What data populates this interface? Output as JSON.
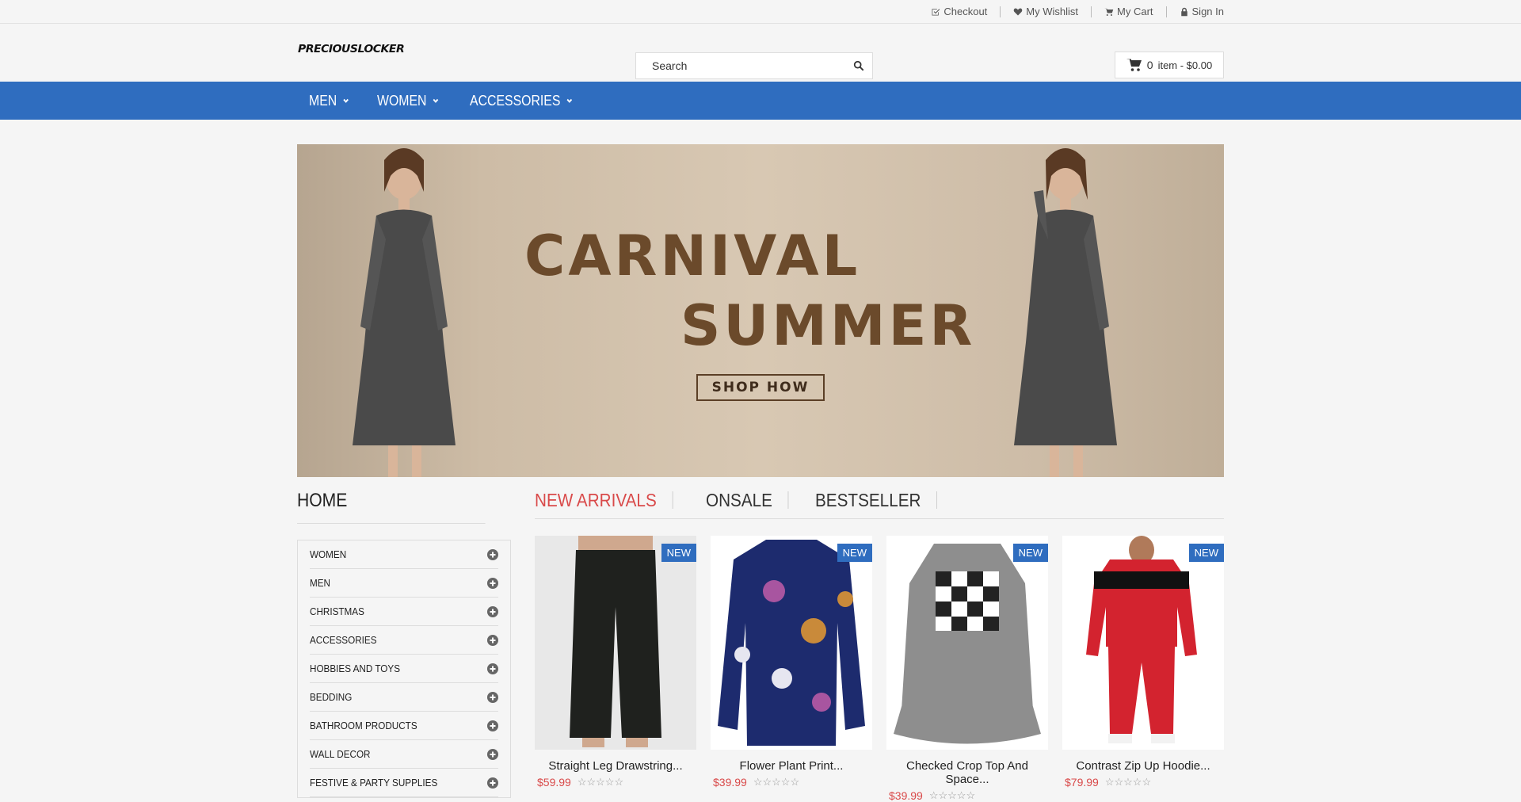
{
  "toplinks": [
    {
      "label": "Checkout",
      "icon": "checkout-icon"
    },
    {
      "label": "My Wishlist",
      "icon": "heart-icon"
    },
    {
      "label": "My Cart",
      "icon": "cart-icon"
    },
    {
      "label": "Sign In",
      "icon": "lock-icon"
    }
  ],
  "header": {
    "logo": "PRECIOUSLOCKER",
    "search_placeholder": "Search",
    "cart_count": "0",
    "cart_summary": "item - $0.00"
  },
  "nav": [
    {
      "label": "MEN"
    },
    {
      "label": "WOMEN"
    },
    {
      "label": "ACCESSORIES"
    }
  ],
  "banner": {
    "line1": "CARNIVAL",
    "line2": "SUMMER",
    "button": "SHOP HOW"
  },
  "sidebar": {
    "title": "HOME",
    "categories": [
      "WOMEN",
      "MEN",
      "CHRISTMAS",
      "ACCESSORIES",
      "HOBBIES AND TOYS",
      "BEDDING",
      "BATHROOM PRODUCTS",
      "WALL DECOR",
      "FESTIVE & PARTY SUPPLIES"
    ]
  },
  "tabs": [
    "NEW ARRIVALS",
    "ONSALE",
    "BESTSELLER"
  ],
  "products": [
    {
      "name": "Straight Leg Drawstring...",
      "price": "$59.99",
      "badge": "NEW",
      "stars": "☆☆☆☆☆"
    },
    {
      "name": "Flower Plant Print...",
      "price": "$39.99",
      "badge": "NEW",
      "stars": "☆☆☆☆☆"
    },
    {
      "name": "Checked Crop Top And Space...",
      "price": "$39.99",
      "badge": "NEW",
      "stars": "☆☆☆☆☆"
    },
    {
      "name": "Contrast Zip Up Hoodie...",
      "price": "$79.99",
      "badge": "NEW",
      "stars": "☆☆☆☆☆"
    }
  ],
  "colors": {
    "nav_blue": "#2f6dbf",
    "accent_red": "#d94a4a",
    "banner_text": "#6b4a2b"
  }
}
